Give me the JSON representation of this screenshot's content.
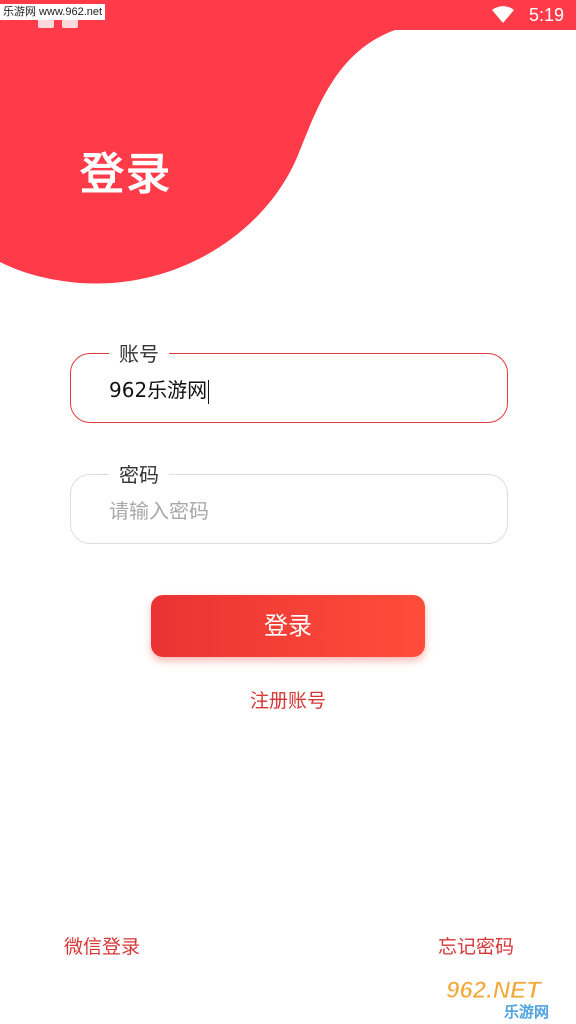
{
  "watermark": "乐游网 www.962.net",
  "status": {
    "time": "5:19"
  },
  "header": {
    "title": "登录"
  },
  "account": {
    "label": "账号",
    "value": "962乐游网"
  },
  "password": {
    "label": "密码",
    "placeholder": "请输入密码"
  },
  "actions": {
    "login_label": "登录",
    "register_label": "注册账号",
    "wechat_label": "微信登录",
    "forgot_label": "忘记密码"
  },
  "logo": {
    "top": "962.NET",
    "bottom": "乐游网"
  },
  "colors": {
    "accent": "#ff3b4a",
    "link": "#d63636",
    "button_start": "#e93333",
    "button_end": "#ff4d3a"
  },
  "icons": [
    "wifi-icon"
  ]
}
